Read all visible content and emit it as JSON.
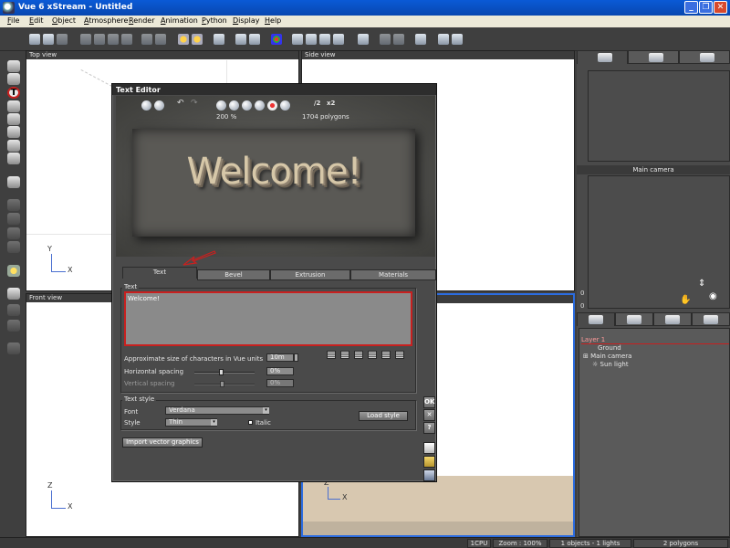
{
  "window": {
    "title": "Vue 6 xStream - Untitled"
  },
  "menu": [
    "File",
    "Edit",
    "Object",
    "Atmosphere",
    "Render",
    "Animation",
    "Python",
    "Display",
    "Help"
  ],
  "viewports": {
    "top": {
      "title": "Top view",
      "axis_y": "Y",
      "axis_x": "X"
    },
    "side": {
      "title": "Side view"
    },
    "front": {
      "title": "Front view",
      "axis_z": "Z",
      "axis_x": "X"
    },
    "main_camera": {
      "title": "Main camera",
      "axis_z": "Z",
      "axis_x": "X"
    }
  },
  "text_editor": {
    "title": "Text Editor",
    "zoom": "200 %",
    "polygons": "1704 polygons",
    "divide_label": "/2",
    "multiply_label": "x2",
    "preview_text": "Welcome!",
    "tabs": [
      "Text",
      "Bevel",
      "Extrusion",
      "Materials"
    ],
    "active_tab": "Text",
    "text_group_label": "Text",
    "text_value": "Welcome!",
    "size_label": "Approximate size of characters in Vue units",
    "size_value": "10m",
    "horizontal_spacing_label": "Horizontal spacing",
    "horizontal_spacing_value": "0%",
    "horizontal_spacing_level": 0.45,
    "vertical_spacing_label": "Vertical spacing",
    "vertical_spacing_value": "0%",
    "text_style_label": "Text style",
    "font_label": "Font",
    "font_value": "Verdana",
    "style_label": "Style",
    "style_value": "Thin",
    "italic_label": "Italic",
    "load_style_label": "Load style",
    "import_vector_label": "Import vector graphics",
    "ok_label": "OK",
    "cancel_label": "✕",
    "help_label": "?"
  },
  "right_panel": {
    "camera_label": "Main camera",
    "layer": "Layer 1",
    "objects": [
      "Ground",
      "Main camera",
      "Sun light"
    ],
    "side_numbers": [
      "0",
      "0"
    ]
  },
  "status": {
    "cpu": "1CPU",
    "zoom": "Zoom : 100%",
    "objects": "1 objects - 1 lights",
    "polygons": "2 polygons"
  },
  "colors": {
    "accent_red": "#c8201f",
    "title_blue": "#0a5ad6"
  }
}
